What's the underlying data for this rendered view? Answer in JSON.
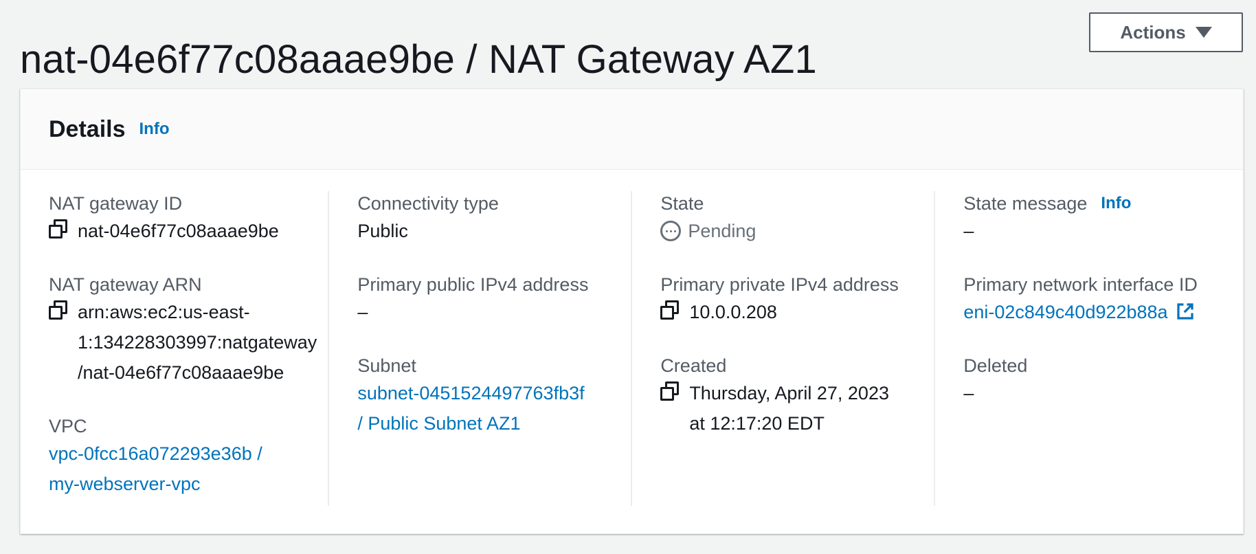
{
  "header": {
    "title": "nat-04e6f77c08aaae9be / NAT Gateway AZ1",
    "actions_label": "Actions"
  },
  "details": {
    "title": "Details",
    "info": "Info",
    "columns": [
      [
        {
          "label": "NAT gateway ID",
          "lines": [
            "nat-04e6f77c08aaae9be"
          ],
          "copy": true
        },
        {
          "label": "NAT gateway ARN",
          "lines": [
            "arn:aws:ec2:us-east-",
            "1:134228303997:natgateway",
            "/nat-04e6f77c08aaae9be"
          ],
          "copy": true
        },
        {
          "label": "VPC",
          "lines": [
            "vpc-0fcc16a072293e36b /",
            "my-webserver-vpc"
          ],
          "link": true
        }
      ],
      [
        {
          "label": "Connectivity type",
          "lines": [
            "Public"
          ]
        },
        {
          "label": "Primary public IPv4 address",
          "lines": [
            "–"
          ]
        },
        {
          "label": "Subnet",
          "lines": [
            "subnet-0451524497763fb3f",
            "/ Public Subnet AZ1"
          ],
          "link": true
        }
      ],
      [
        {
          "label": "State",
          "lines": [
            "Pending"
          ],
          "status": "pending"
        },
        {
          "label": "Primary private IPv4 address",
          "lines": [
            "10.0.0.208"
          ],
          "copy": true
        },
        {
          "label": "Created",
          "lines": [
            "Thursday, April 27, 2023",
            "at 12:17:20 EDT"
          ],
          "copy": true
        }
      ],
      [
        {
          "label": "State message",
          "lines": [
            "–"
          ],
          "info": "Info"
        },
        {
          "label": "Primary network interface ID",
          "lines": [
            "eni-02c849c40d922b88a"
          ],
          "link": true,
          "external": true
        },
        {
          "label": "Deleted",
          "lines": [
            "–"
          ]
        }
      ]
    ]
  },
  "icons": {
    "copy": "copy-icon",
    "external": "external-link-icon",
    "pending": "pending-status-icon",
    "caret": "caret-down-icon"
  },
  "colors": {
    "link": "#0073bb",
    "text": "#16191f",
    "label": "#545b64",
    "status_pending": "#687078",
    "background": "#f2f3f3"
  }
}
